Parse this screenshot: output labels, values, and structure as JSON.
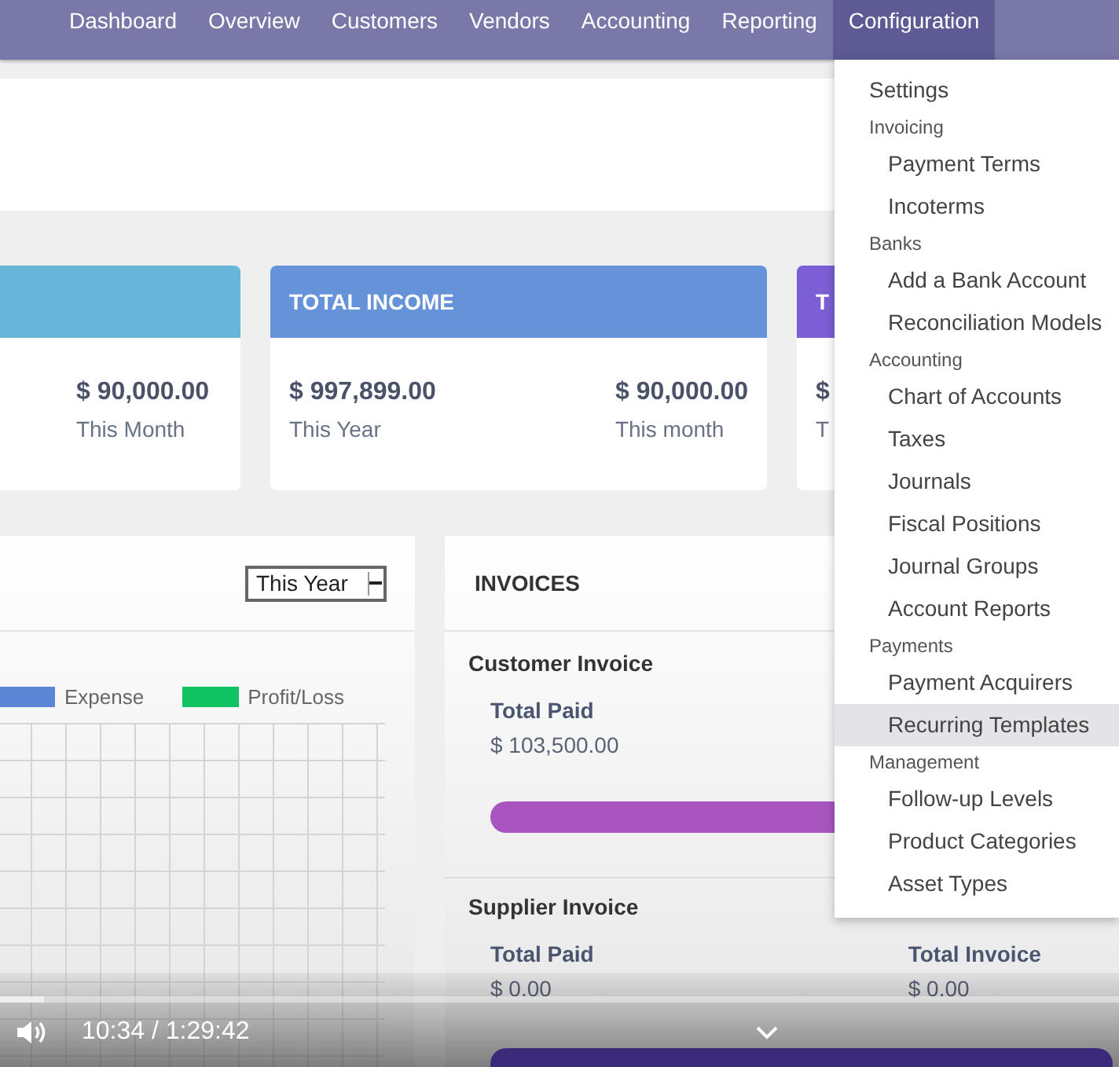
{
  "nav": {
    "items": [
      {
        "label": "Dashboard",
        "selected": false
      },
      {
        "label": "Overview",
        "selected": false
      },
      {
        "label": "Customers",
        "selected": false
      },
      {
        "label": "Vendors",
        "selected": false
      },
      {
        "label": "Accounting",
        "selected": false
      },
      {
        "label": "Reporting",
        "selected": false
      },
      {
        "label": "Configuration",
        "selected": true
      }
    ]
  },
  "cards": [
    {
      "color": "#67b6da",
      "stats": [
        {
          "value": "$ 90,000.00",
          "caption": "This Month"
        }
      ]
    },
    {
      "title": "TOTAL INCOME",
      "color": "#6592d9",
      "stats": [
        {
          "value": "$ 997,899.00",
          "caption": "This Year"
        },
        {
          "value": "$ 90,000.00",
          "caption": "This month"
        }
      ]
    },
    {
      "title": "T",
      "color": "#7c5fd4",
      "stats": [
        {
          "value": "$",
          "caption": "T"
        }
      ]
    }
  ],
  "chart_panel": {
    "period": "This Year",
    "legend": [
      {
        "label": "Expense",
        "color": "#5b86d6"
      },
      {
        "label": "Profit/Loss",
        "color": "#10c261"
      }
    ]
  },
  "invoices": {
    "title": "INVOICES",
    "groups": [
      {
        "title": "Customer Invoice",
        "stats": [
          {
            "label": "Total Paid",
            "value": "$ 103,500.00"
          }
        ],
        "color": "#a855c0"
      },
      {
        "title": "Supplier Invoice",
        "stats": [
          {
            "label": "Total Paid",
            "value": "$ 0.00"
          },
          {
            "label": "Total Invoice",
            "value": "$ 0.00"
          }
        ],
        "color": "#3b2a7a"
      }
    ]
  },
  "menu": {
    "sections": [
      {
        "items": [
          {
            "label": "Settings",
            "highlighted": false
          }
        ]
      },
      {
        "title": "Invoicing",
        "items": [
          {
            "label": "Payment Terms",
            "highlighted": false
          },
          {
            "label": "Incoterms",
            "highlighted": false
          }
        ]
      },
      {
        "title": "Banks",
        "items": [
          {
            "label": "Add a Bank Account",
            "highlighted": false
          },
          {
            "label": "Reconciliation Models",
            "highlighted": false
          }
        ]
      },
      {
        "title": "Accounting",
        "items": [
          {
            "label": "Chart of Accounts",
            "highlighted": false
          },
          {
            "label": "Taxes",
            "highlighted": false
          },
          {
            "label": "Journals",
            "highlighted": false
          },
          {
            "label": "Fiscal Positions",
            "highlighted": false
          },
          {
            "label": "Journal Groups",
            "highlighted": false
          },
          {
            "label": "Account Reports",
            "highlighted": false
          }
        ]
      },
      {
        "title": "Payments",
        "items": [
          {
            "label": "Payment Acquirers",
            "highlighted": false
          },
          {
            "label": "Recurring Templates",
            "highlighted": true
          }
        ]
      },
      {
        "title": "Management",
        "items": [
          {
            "label": "Follow-up Levels",
            "highlighted": false
          },
          {
            "label": "Product Categories",
            "highlighted": false
          },
          {
            "label": "Asset Types",
            "highlighted": false
          }
        ]
      }
    ]
  },
  "player": {
    "time": "10:34 / 1:29:42",
    "level": 0.04
  }
}
